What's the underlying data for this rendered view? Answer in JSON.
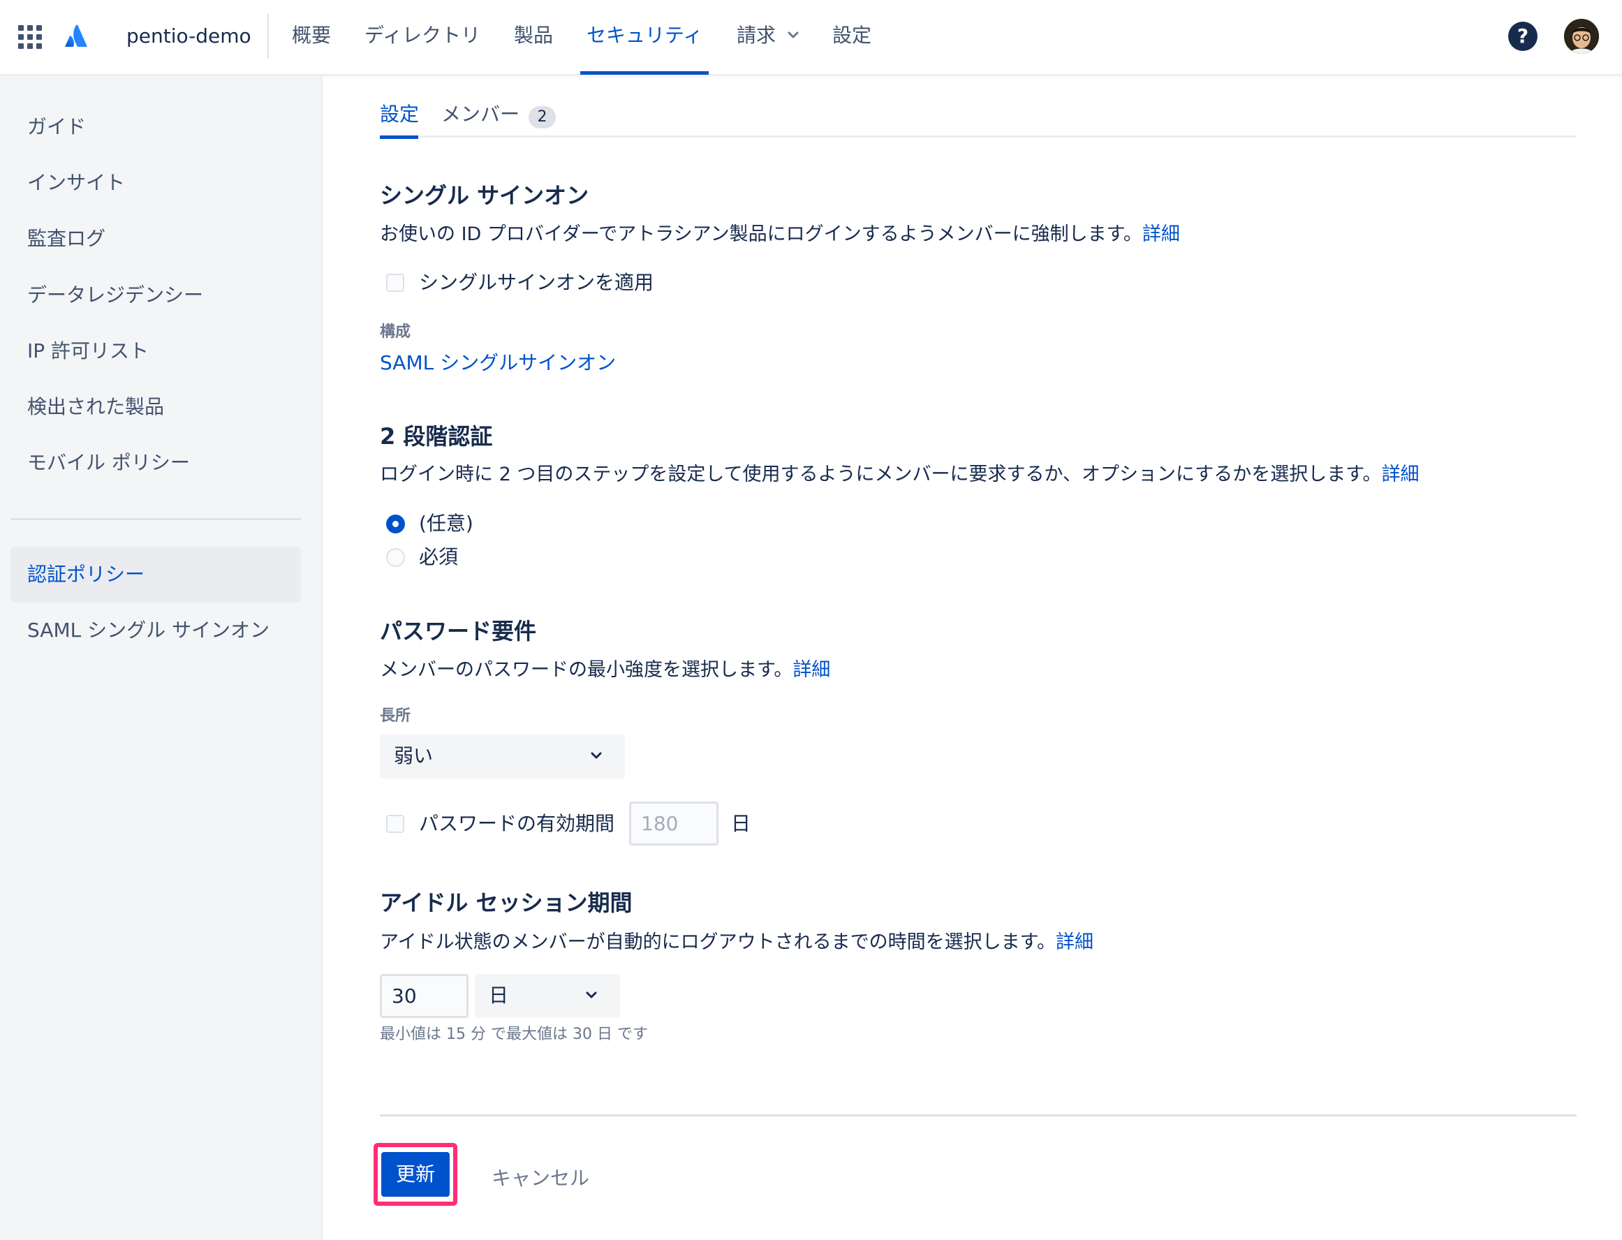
{
  "topnav": {
    "org_name": "pentio-demo",
    "items": [
      {
        "label": "概要",
        "icon": "app-switcher-icon"
      },
      {
        "label": "ディレクトリ"
      },
      {
        "label": "製品"
      },
      {
        "label": "セキュリティ",
        "active": true
      },
      {
        "label": "請求",
        "has_dropdown": true
      },
      {
        "label": "設定"
      }
    ],
    "help_label": "?",
    "accent_color": "#0052cc"
  },
  "sidebar": {
    "items": [
      {
        "label": "ガイド"
      },
      {
        "label": "インサイト"
      },
      {
        "label": "監査ログ"
      },
      {
        "label": "データレジデンシー"
      },
      {
        "label": "IP 許可リスト"
      },
      {
        "label": "検出された製品"
      },
      {
        "label": "モバイル ポリシー"
      },
      {
        "label": "認証ポリシー",
        "active": true
      },
      {
        "label": "SAML シングル サインオン"
      }
    ]
  },
  "tabs": [
    {
      "label": "設定",
      "active": true
    },
    {
      "label": "メンバー",
      "badge": "2"
    }
  ],
  "sso": {
    "title": "シングル サインオン",
    "description": "お使いの ID プロバイダーでアトラシアン製品にログインするようメンバーに強制します。",
    "learn_more": "詳細",
    "checkbox_label": "シングルサインオンを適用",
    "checked": false,
    "config_label": "構成",
    "config_link": "SAML シングルサインオン"
  },
  "two_step": {
    "title": "2 段階認証",
    "description": "ログイン時に 2 つ目のステップを設定して使用するようにメンバーに要求するか、オプションにするかを選択します。",
    "learn_more": "詳細",
    "options": [
      {
        "label": "(任意)",
        "selected": true
      },
      {
        "label": "必須",
        "selected": false
      }
    ]
  },
  "password": {
    "title": "パスワード要件",
    "description": "メンバーのパスワードの最小強度を選択します。",
    "learn_more": "詳細",
    "strength_label": "長所",
    "strength_value": "弱い",
    "expiry_label": "パスワードの有効期間",
    "expiry_checked": false,
    "expiry_placeholder": "180",
    "expiry_unit": "日"
  },
  "idle": {
    "title": "アイドル セッション期間",
    "description": "アイドル状態のメンバーが自動的にログアウトされるまでの時間を選択します。",
    "learn_more": "詳細",
    "value": "30",
    "unit_value": "日",
    "hint": "最小値は 15 分 で最大値は 30 日 です"
  },
  "actions": {
    "update_label": "更新",
    "cancel_label": "キャンセル",
    "highlight_color": "#ff2d78"
  }
}
